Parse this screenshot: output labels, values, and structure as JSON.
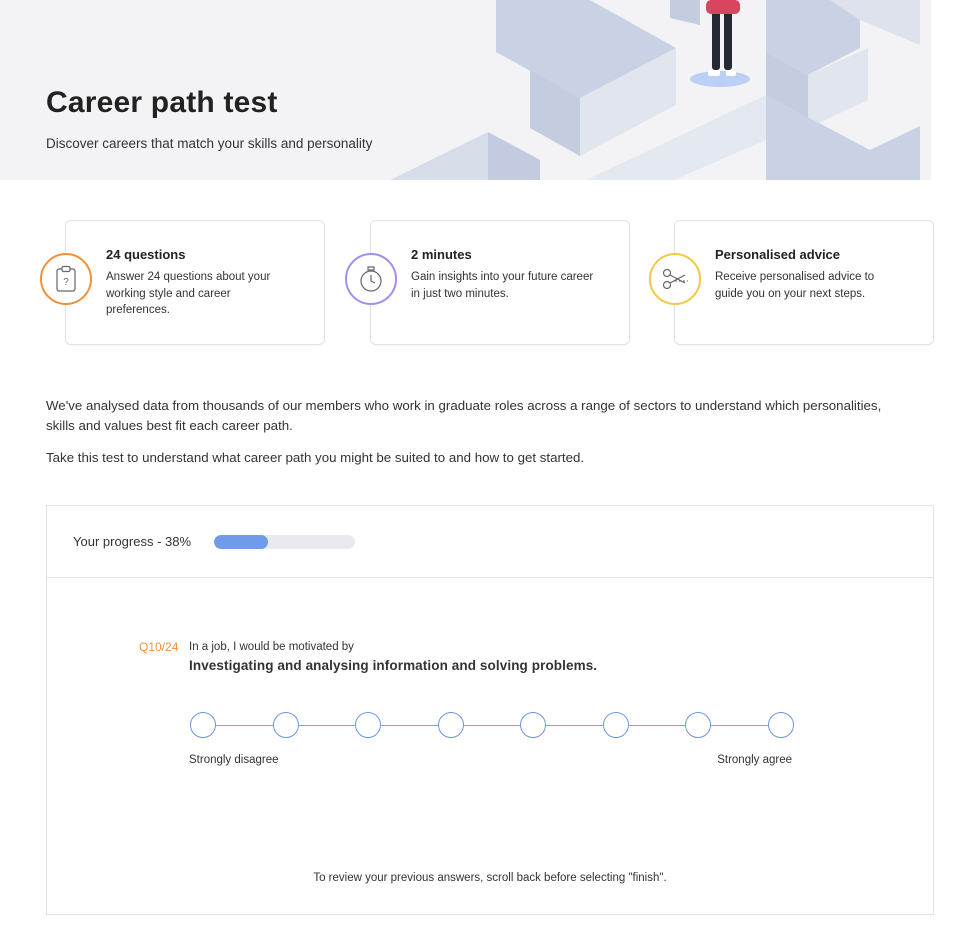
{
  "hero": {
    "title": "Career path test",
    "subtitle": "Discover careers that match your skills and personality"
  },
  "features": [
    {
      "icon": "clipboard-question-icon",
      "color": "#f0913a",
      "title": "24 questions",
      "text": "Answer 24 questions about your working style and career preferences."
    },
    {
      "icon": "stopwatch-icon",
      "color": "#a58cf0",
      "title": "2 minutes",
      "text": "Gain insights into your future career in just two minutes."
    },
    {
      "icon": "scissors-icon",
      "color": "#f5c842",
      "title": "Personalised advice",
      "text": "Receive personalised advice to guide you on your next steps."
    }
  ],
  "intro": {
    "paragraph1": "We've analysed data from thousands of our members who work in graduate roles across a range of sectors to understand which personalities, skills and values best fit each career path.",
    "paragraph2": "Take this test to understand what career path you might be suited to and how to get started."
  },
  "progress": {
    "label": "Your progress - 38%",
    "value": 0.38,
    "color": "#6f9bea"
  },
  "question": {
    "number": "Q10/24",
    "prompt": "In a job, I would be motivated by",
    "text": "Investigating and analysing information and solving problems.",
    "scale_points": 8,
    "scale_min_label": "Strongly disagree",
    "scale_max_label": "Strongly agree"
  },
  "footer_note": "To review your previous answers, scroll back before selecting \"finish\"."
}
